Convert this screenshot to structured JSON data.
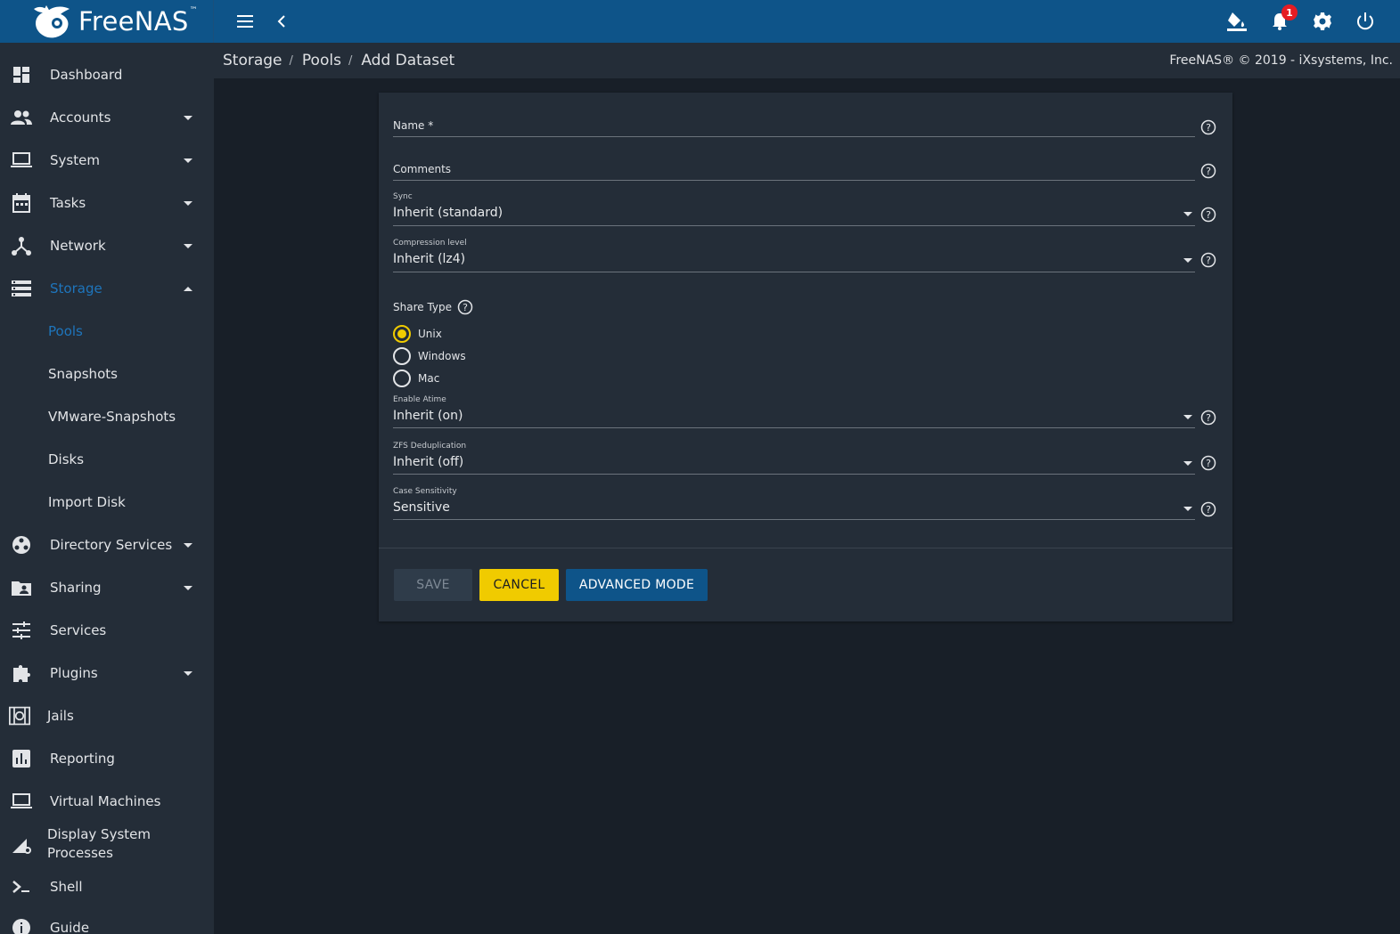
{
  "app": {
    "logo_text": "FreeNAS",
    "logo_tm": "™",
    "notification_count": "1"
  },
  "breadcrumb": {
    "items": [
      "Storage",
      "Pools",
      "Add Dataset"
    ],
    "separator": "/"
  },
  "copyright": "FreeNAS® © 2019 - iXsystems, Inc.",
  "sidebar": {
    "items": [
      {
        "label": "Dashboard",
        "icon": "dashboard-icon"
      },
      {
        "label": "Accounts",
        "icon": "accounts-icon"
      },
      {
        "label": "System",
        "icon": "laptop-icon"
      },
      {
        "label": "Tasks",
        "icon": "calendar-icon"
      },
      {
        "label": "Network",
        "icon": "network-icon"
      },
      {
        "label": "Storage",
        "icon": "storage-icon"
      },
      {
        "label": "Directory Services",
        "icon": "directory-icon"
      },
      {
        "label": "Sharing",
        "icon": "sharing-icon"
      },
      {
        "label": "Services",
        "icon": "tune-icon"
      },
      {
        "label": "Plugins",
        "icon": "puzzle-icon"
      },
      {
        "label": "Jails",
        "icon": "jail-icon"
      },
      {
        "label": "Reporting",
        "icon": "chart-icon"
      },
      {
        "label": "Virtual Machines",
        "icon": "laptop-icon"
      },
      {
        "label": "Display System Processes",
        "icon": "process-icon"
      },
      {
        "label": "Shell",
        "icon": "shell-icon"
      },
      {
        "label": "Guide",
        "icon": "info-icon"
      }
    ],
    "storage_sub": [
      "Pools",
      "Snapshots",
      "VMware-Snapshots",
      "Disks",
      "Import Disk"
    ]
  },
  "form": {
    "name_label": "Name *",
    "comments_label": "Comments",
    "sync": {
      "label": "Sync",
      "value": "Inherit (standard)"
    },
    "compression": {
      "label": "Compression level",
      "value": "Inherit (lz4)"
    },
    "share_type": {
      "label": "Share Type",
      "options": [
        "Unix",
        "Windows",
        "Mac"
      ],
      "selected": "Unix"
    },
    "atime": {
      "label": "Enable Atime",
      "value": "Inherit (on)"
    },
    "dedup": {
      "label": "ZFS Deduplication",
      "value": "Inherit (off)"
    },
    "case": {
      "label": "Case Sensitivity",
      "value": "Sensitive"
    }
  },
  "buttons": {
    "save": "SAVE",
    "cancel": "CANCEL",
    "advanced": "ADVANCED MODE"
  },
  "colors": {
    "topbar": "#0e5489",
    "sidebar": "#242d38",
    "background": "#181f28",
    "active": "#1e75bc",
    "accent_yellow": "#f0cb00"
  }
}
